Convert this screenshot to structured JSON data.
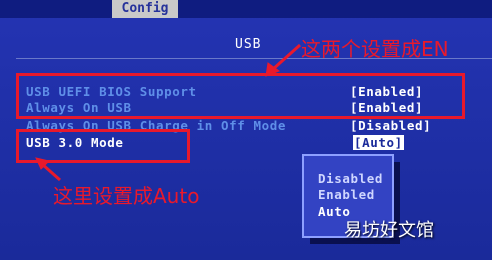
{
  "header": {
    "tab_label": "Config",
    "section_title": "USB"
  },
  "settings": [
    {
      "label": "USB UEFI BIOS Support",
      "value": "[Enabled]"
    },
    {
      "label": "Always On USB",
      "value": "[Enabled]"
    },
    {
      "label": "Always On USB Charge in Off Mode",
      "value": "[Disabled]"
    },
    {
      "label": "USB 3.0 Mode",
      "value": "[Auto]"
    }
  ],
  "popup": {
    "options": [
      "Disabled",
      "Enabled",
      "Auto"
    ],
    "selected": "Auto"
  },
  "annotations": {
    "top_note": "这两个设置成EN",
    "bottom_note": "这里设置成Auto",
    "highlight_color": "#e8192c"
  },
  "watermark": "易坊好文馆",
  "colors": {
    "bios_bg": "#1f2fa3",
    "label_blue": "#5f8fe8",
    "text_white": "#ffffff"
  }
}
